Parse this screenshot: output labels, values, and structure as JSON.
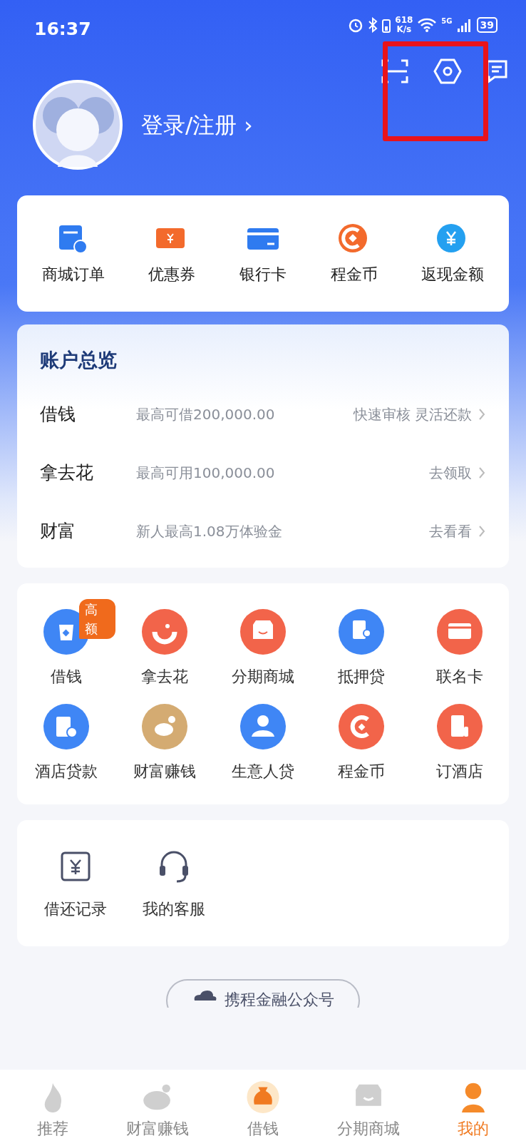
{
  "status_bar": {
    "time": "16:37",
    "speed": [
      "618",
      "K/s"
    ],
    "network": "5G",
    "battery": "39"
  },
  "profile": {
    "login": "登录/注册",
    "chevron": "›"
  },
  "quick_links": [
    {
      "label": "商城订单"
    },
    {
      "label": "优惠券"
    },
    {
      "label": "银行卡"
    },
    {
      "label": "程金币"
    },
    {
      "label": "返现金额"
    }
  ],
  "account": {
    "title": "账户总览",
    "rows": [
      {
        "name": "借钱",
        "detail": "最高可借200,000.00",
        "action": "快速审核 灵活还款"
      },
      {
        "name": "拿去花",
        "detail": "最高可用100,000.00",
        "action": "去领取"
      },
      {
        "name": "财富",
        "detail": "新人最高1.08万体验金",
        "action": "去看看"
      }
    ]
  },
  "services": [
    {
      "label": "借钱",
      "color": "#3f86f5",
      "badge": "高额"
    },
    {
      "label": "拿去花",
      "color": "#f2644a"
    },
    {
      "label": "分期商城",
      "color": "#f2644a"
    },
    {
      "label": "抵押贷",
      "color": "#3f86f5"
    },
    {
      "label": "联名卡",
      "color": "#f2644a"
    },
    {
      "label": "酒店贷款",
      "color": "#3f86f5"
    },
    {
      "label": "财富赚钱",
      "color": "#d4ab72"
    },
    {
      "label": "生意人贷",
      "color": "#3f86f5"
    },
    {
      "label": "程金币",
      "color": "#f2644a"
    },
    {
      "label": "订酒店",
      "color": "#f2644a"
    }
  ],
  "tools": [
    {
      "label": "借还记录"
    },
    {
      "label": "我的客服"
    }
  ],
  "follow_pill": {
    "label": "携程金融公众号"
  },
  "nav": [
    {
      "label": "推荐",
      "selected": false
    },
    {
      "label": "财富赚钱",
      "selected": false
    },
    {
      "label": "借钱",
      "selected": false
    },
    {
      "label": "分期商城",
      "selected": false
    },
    {
      "label": "我的",
      "selected": true
    }
  ]
}
